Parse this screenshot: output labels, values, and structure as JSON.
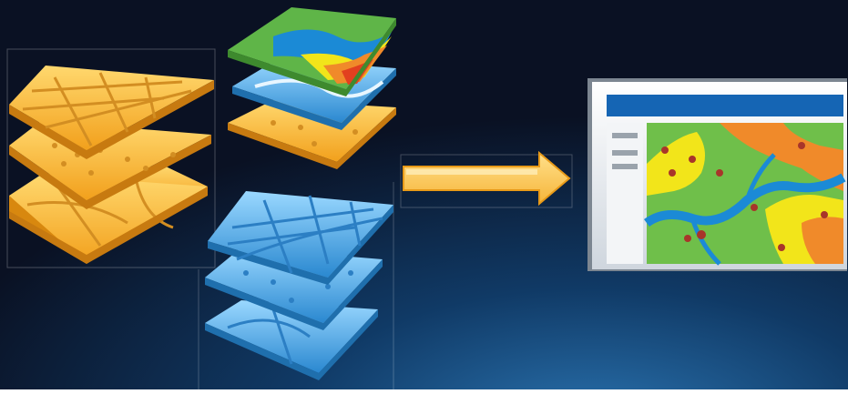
{
  "scene": {
    "background": {
      "top": "#0b1224",
      "bottom": "#0f3b66",
      "glow": "#1a5a8f"
    },
    "layer_stacks": [
      {
        "name": "orange-stack",
        "color_top": "#ffd36a",
        "color_bottom": "#f3a21a",
        "line": "#c8841c"
      },
      {
        "name": "thematic-stack",
        "layers": [
          "green-yellow-orange-map",
          "blue-water-layer",
          "orange-points-layer"
        ]
      },
      {
        "name": "blue-stack",
        "color_top": "#8fd2ff",
        "color_bottom": "#2a8fd6",
        "line": "#1f6fad"
      }
    ],
    "arrow": {
      "fill": "#ffd36a",
      "stroke": "#e89a18",
      "direction": "right"
    },
    "app_window": {
      "titlebar_color": "#1565b4",
      "sidebar_items": 3,
      "map_colors": [
        "#6fbf4a",
        "#f2e51a",
        "#f08a2a",
        "#1b8ad6"
      ]
    }
  }
}
